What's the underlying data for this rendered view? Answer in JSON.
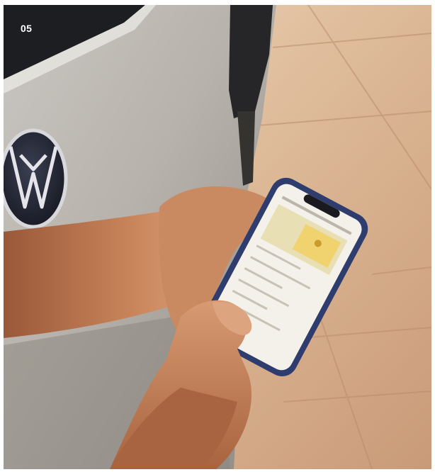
{
  "photo": {
    "page_number": "05",
    "subject": "hand-holding-smartphone-next-to-car",
    "colors": {
      "car_body": "#b9b4ad",
      "pavement": "#d9b896",
      "skin": "#c27d55",
      "phone_frame": "#2f3d6e"
    }
  },
  "phone_screen": {
    "map_marker_icon": "map-pin-icon"
  }
}
